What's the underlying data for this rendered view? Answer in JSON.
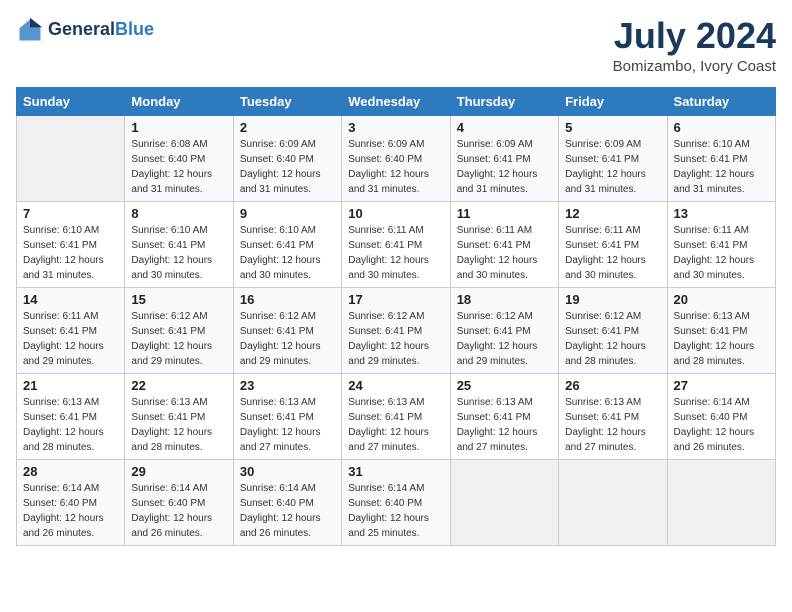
{
  "header": {
    "logo_line1": "General",
    "logo_line2": "Blue",
    "month": "July 2024",
    "location": "Bomizambo, Ivory Coast"
  },
  "columns": [
    "Sunday",
    "Monday",
    "Tuesday",
    "Wednesday",
    "Thursday",
    "Friday",
    "Saturday"
  ],
  "weeks": [
    [
      {
        "day": "",
        "sunrise": "",
        "sunset": "",
        "daylight": ""
      },
      {
        "day": "1",
        "sunrise": "6:08 AM",
        "sunset": "6:40 PM",
        "daylight": "12 hours and 31 minutes."
      },
      {
        "day": "2",
        "sunrise": "6:09 AM",
        "sunset": "6:40 PM",
        "daylight": "12 hours and 31 minutes."
      },
      {
        "day": "3",
        "sunrise": "6:09 AM",
        "sunset": "6:40 PM",
        "daylight": "12 hours and 31 minutes."
      },
      {
        "day": "4",
        "sunrise": "6:09 AM",
        "sunset": "6:41 PM",
        "daylight": "12 hours and 31 minutes."
      },
      {
        "day": "5",
        "sunrise": "6:09 AM",
        "sunset": "6:41 PM",
        "daylight": "12 hours and 31 minutes."
      },
      {
        "day": "6",
        "sunrise": "6:10 AM",
        "sunset": "6:41 PM",
        "daylight": "12 hours and 31 minutes."
      }
    ],
    [
      {
        "day": "7",
        "sunrise": "6:10 AM",
        "sunset": "6:41 PM",
        "daylight": "12 hours and 31 minutes."
      },
      {
        "day": "8",
        "sunrise": "6:10 AM",
        "sunset": "6:41 PM",
        "daylight": "12 hours and 30 minutes."
      },
      {
        "day": "9",
        "sunrise": "6:10 AM",
        "sunset": "6:41 PM",
        "daylight": "12 hours and 30 minutes."
      },
      {
        "day": "10",
        "sunrise": "6:11 AM",
        "sunset": "6:41 PM",
        "daylight": "12 hours and 30 minutes."
      },
      {
        "day": "11",
        "sunrise": "6:11 AM",
        "sunset": "6:41 PM",
        "daylight": "12 hours and 30 minutes."
      },
      {
        "day": "12",
        "sunrise": "6:11 AM",
        "sunset": "6:41 PM",
        "daylight": "12 hours and 30 minutes."
      },
      {
        "day": "13",
        "sunrise": "6:11 AM",
        "sunset": "6:41 PM",
        "daylight": "12 hours and 30 minutes."
      }
    ],
    [
      {
        "day": "14",
        "sunrise": "6:11 AM",
        "sunset": "6:41 PM",
        "daylight": "12 hours and 29 minutes."
      },
      {
        "day": "15",
        "sunrise": "6:12 AM",
        "sunset": "6:41 PM",
        "daylight": "12 hours and 29 minutes."
      },
      {
        "day": "16",
        "sunrise": "6:12 AM",
        "sunset": "6:41 PM",
        "daylight": "12 hours and 29 minutes."
      },
      {
        "day": "17",
        "sunrise": "6:12 AM",
        "sunset": "6:41 PM",
        "daylight": "12 hours and 29 minutes."
      },
      {
        "day": "18",
        "sunrise": "6:12 AM",
        "sunset": "6:41 PM",
        "daylight": "12 hours and 29 minutes."
      },
      {
        "day": "19",
        "sunrise": "6:12 AM",
        "sunset": "6:41 PM",
        "daylight": "12 hours and 28 minutes."
      },
      {
        "day": "20",
        "sunrise": "6:13 AM",
        "sunset": "6:41 PM",
        "daylight": "12 hours and 28 minutes."
      }
    ],
    [
      {
        "day": "21",
        "sunrise": "6:13 AM",
        "sunset": "6:41 PM",
        "daylight": "12 hours and 28 minutes."
      },
      {
        "day": "22",
        "sunrise": "6:13 AM",
        "sunset": "6:41 PM",
        "daylight": "12 hours and 28 minutes."
      },
      {
        "day": "23",
        "sunrise": "6:13 AM",
        "sunset": "6:41 PM",
        "daylight": "12 hours and 27 minutes."
      },
      {
        "day": "24",
        "sunrise": "6:13 AM",
        "sunset": "6:41 PM",
        "daylight": "12 hours and 27 minutes."
      },
      {
        "day": "25",
        "sunrise": "6:13 AM",
        "sunset": "6:41 PM",
        "daylight": "12 hours and 27 minutes."
      },
      {
        "day": "26",
        "sunrise": "6:13 AM",
        "sunset": "6:41 PM",
        "daylight": "12 hours and 27 minutes."
      },
      {
        "day": "27",
        "sunrise": "6:14 AM",
        "sunset": "6:40 PM",
        "daylight": "12 hours and 26 minutes."
      }
    ],
    [
      {
        "day": "28",
        "sunrise": "6:14 AM",
        "sunset": "6:40 PM",
        "daylight": "12 hours and 26 minutes."
      },
      {
        "day": "29",
        "sunrise": "6:14 AM",
        "sunset": "6:40 PM",
        "daylight": "12 hours and 26 minutes."
      },
      {
        "day": "30",
        "sunrise": "6:14 AM",
        "sunset": "6:40 PM",
        "daylight": "12 hours and 26 minutes."
      },
      {
        "day": "31",
        "sunrise": "6:14 AM",
        "sunset": "6:40 PM",
        "daylight": "12 hours and 25 minutes."
      },
      {
        "day": "",
        "sunrise": "",
        "sunset": "",
        "daylight": ""
      },
      {
        "day": "",
        "sunrise": "",
        "sunset": "",
        "daylight": ""
      },
      {
        "day": "",
        "sunrise": "",
        "sunset": "",
        "daylight": ""
      }
    ]
  ],
  "labels": {
    "sunrise_prefix": "Sunrise: ",
    "sunset_prefix": "Sunset: ",
    "daylight_prefix": "Daylight: "
  }
}
